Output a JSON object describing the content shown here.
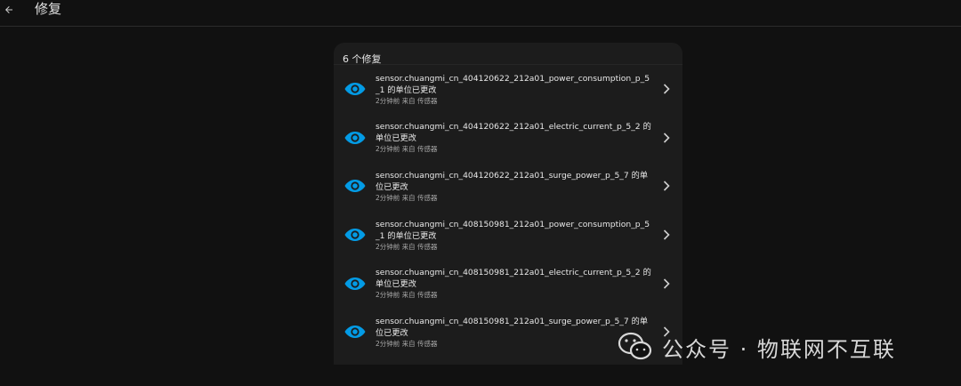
{
  "header": {
    "back_icon": "arrow-left-icon",
    "title": "修复"
  },
  "card": {
    "count_label": "6 个修复",
    "items": [
      {
        "icon": "eye-icon",
        "title": "sensor.chuangmi_cn_404120622_212a01_power_consumption_p_5_1 的单位已更改",
        "meta": "2分钟前 来自 传感器"
      },
      {
        "icon": "eye-icon",
        "title": "sensor.chuangmi_cn_404120622_212a01_electric_current_p_5_2 的单位已更改",
        "meta": "2分钟前 来自 传感器"
      },
      {
        "icon": "eye-icon",
        "title": "sensor.chuangmi_cn_404120622_212a01_surge_power_p_5_7 的单位已更改",
        "meta": "2分钟前 来自 传感器"
      },
      {
        "icon": "eye-icon",
        "title": "sensor.chuangmi_cn_408150981_212a01_power_consumption_p_5_1 的单位已更改",
        "meta": "2分钟前 来自 传感器"
      },
      {
        "icon": "eye-icon",
        "title": "sensor.chuangmi_cn_408150981_212a01_electric_current_p_5_2 的单位已更改",
        "meta": "2分钟前 来自 传感器"
      },
      {
        "icon": "eye-icon",
        "title": "sensor.chuangmi_cn_408150981_212a01_surge_power_p_5_7 的单位已更改",
        "meta": "2分钟前 来自 传感器"
      }
    ]
  },
  "watermark": {
    "text": "公众号 · 物联网不互联"
  },
  "colors": {
    "background": "#111111",
    "card": "#1c1c1c",
    "accent": "#039be5",
    "text": "#e1e1e1",
    "secondary_text": "#a8a8a8"
  }
}
